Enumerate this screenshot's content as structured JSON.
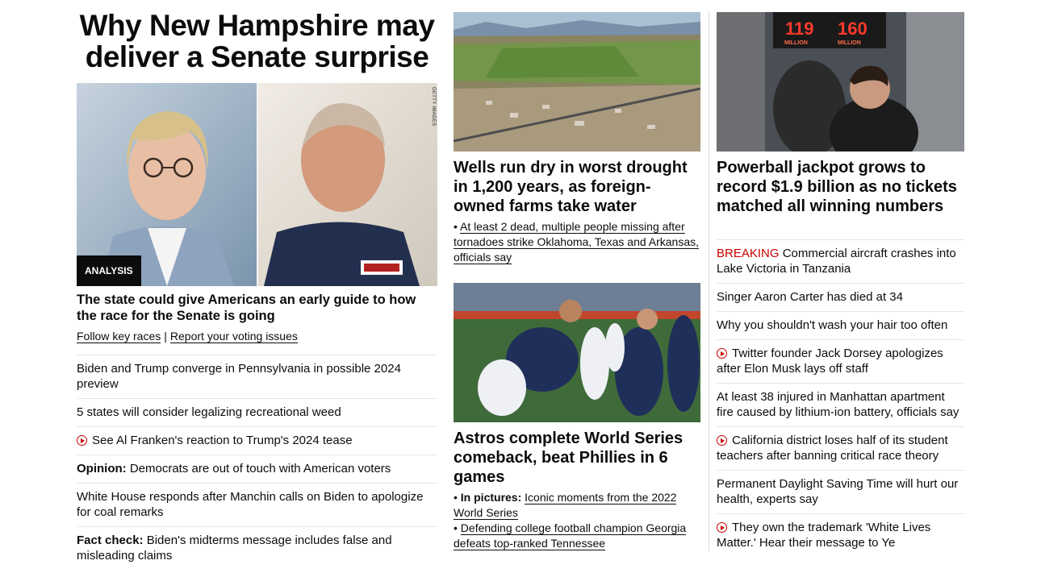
{
  "col1": {
    "headline": "Why New Hampshire may deliver a Senate surprise",
    "image_tag": "ANALYSIS",
    "image_credit": "GETTY IMAGES",
    "subheadline": "The state could give Americans an early guide to how the race for the Senate is going",
    "links": [
      "Follow key races",
      "Report your voting issues"
    ],
    "link_sep": "|",
    "list": [
      {
        "text": "Biden and Trump converge in Pennsylvania in possible 2024 preview"
      },
      {
        "text": "5 states will consider legalizing recreational weed"
      },
      {
        "video": true,
        "text": "See Al Franken's reaction to Trump's 2024 tease"
      },
      {
        "prefix": "Opinion:",
        "text": "Democrats are out of touch with American voters"
      },
      {
        "text": "White House responds after Manchin calls on Biden to apologize for coal remarks"
      },
      {
        "prefix": "Fact check:",
        "text": "Biden's midterms message includes false and misleading claims"
      }
    ]
  },
  "col2": {
    "card1": {
      "title": "Wells run dry in worst drought in 1,200 years, as foreign-owned farms take water",
      "bullet": "• ",
      "links": [
        {
          "text": "At least 2 dead, multiple people missing after tornadoes strike Oklahoma, Texas and Arkansas, officials say"
        }
      ]
    },
    "card2": {
      "title": "Astros complete World Series comeback, beat Phillies in 6 games",
      "bullet": "• ",
      "links": [
        {
          "prefix": "In pictures:",
          "text": "Iconic moments from the 2022 World Series"
        },
        {
          "text": "Defending college football champion Georgia defeats top-ranked Tennessee"
        }
      ]
    }
  },
  "col3": {
    "card": {
      "title": "Powerball jackpot grows to record $1.9 billion as no tickets matched all winning numbers",
      "sign_left_num": "119",
      "sign_right_num": "160",
      "sign_word": "MILLION"
    },
    "list": [
      {
        "breaking": "BREAKING",
        "text": "Commercial aircraft crashes into Lake Victoria in Tanzania"
      },
      {
        "text": "Singer Aaron Carter has died at 34"
      },
      {
        "text": "Why you shouldn't wash your hair too often"
      },
      {
        "video": true,
        "text": "Twitter founder Jack Dorsey apologizes after Elon Musk lays off staff"
      },
      {
        "text": "At least 38 injured in Manhattan apartment fire caused by lithium-ion battery, officials say"
      },
      {
        "video": true,
        "text": "California district loses half of its student teachers after banning critical race theory"
      },
      {
        "text": "Permanent Daylight Saving Time will hurt our health, experts say"
      },
      {
        "video": true,
        "text": "They own the trademark 'White Lives Matter.' Hear their message to Ye"
      }
    ]
  },
  "colors": {
    "breaking": "#cc0000",
    "text": "#0c0c0c",
    "rule": "#e6e6e6"
  }
}
